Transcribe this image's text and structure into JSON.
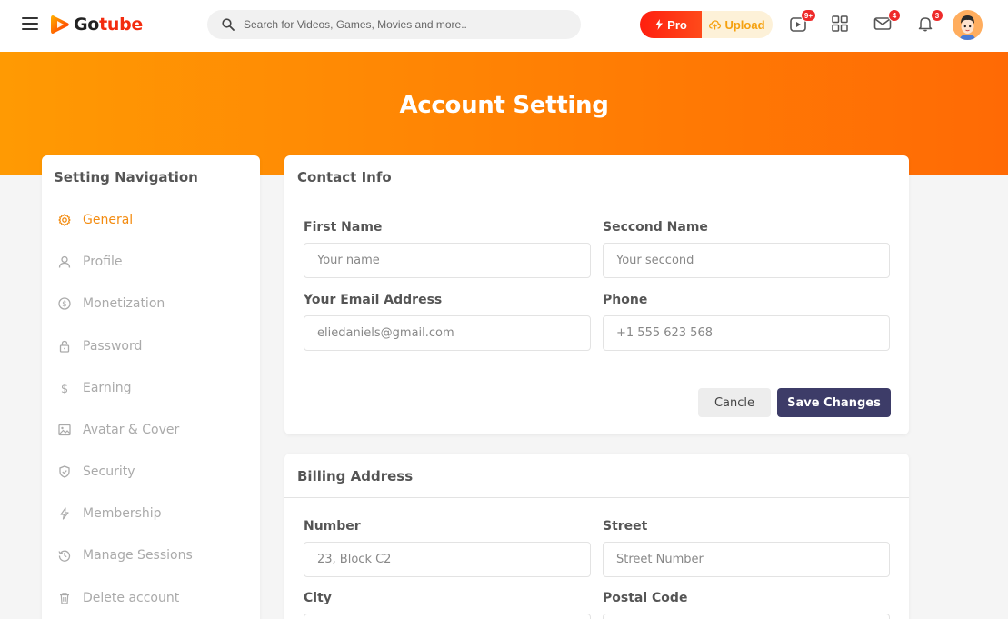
{
  "header": {
    "logo_part1": "Go",
    "logo_part2": "tube",
    "search_placeholder": "Search for Videos, Games, Movies and more..",
    "pro_label": "Pro",
    "upload_label": "Upload",
    "badges": {
      "videos": "9+",
      "mail": "4",
      "notifications": "3"
    }
  },
  "banner": {
    "title": "Account Setting"
  },
  "sidebar": {
    "title": "Setting Navigation",
    "items": [
      {
        "label": "General",
        "icon": "gear-icon",
        "active": true
      },
      {
        "label": "Profile",
        "icon": "user-icon"
      },
      {
        "label": "Monetization",
        "icon": "dollar-circle-icon"
      },
      {
        "label": "Password",
        "icon": "lock-icon"
      },
      {
        "label": "Earning",
        "icon": "dollar-icon"
      },
      {
        "label": "Avatar & Cover",
        "icon": "image-icon"
      },
      {
        "label": "Security",
        "icon": "shield-icon"
      },
      {
        "label": "Membership",
        "icon": "lightning-icon"
      },
      {
        "label": "Manage Sessions",
        "icon": "history-icon"
      },
      {
        "label": "Delete account",
        "icon": "trash-icon"
      }
    ]
  },
  "contact": {
    "title": "Contact Info",
    "first_name_label": "First Name",
    "first_name_placeholder": "Your name",
    "second_name_label": "Seccond Name",
    "second_name_placeholder": "Your seccond",
    "email_label": "Your Email Address",
    "email_placeholder": "eliedaniels@gmail.com",
    "phone_label": "Phone",
    "phone_placeholder": "+1 555 623 568",
    "cancel_label": "Cancle",
    "save_label": "Save Changes"
  },
  "billing": {
    "title": "Billing Address",
    "number_label": "Number",
    "number_placeholder": "23, Block C2",
    "street_label": "Street",
    "street_placeholder": "Street Number",
    "city_label": "City",
    "postal_label": "Postal Code"
  },
  "colors": {
    "accent": "#f38b10",
    "save": "#3d3c68",
    "brand_red": "#f32c0f"
  }
}
